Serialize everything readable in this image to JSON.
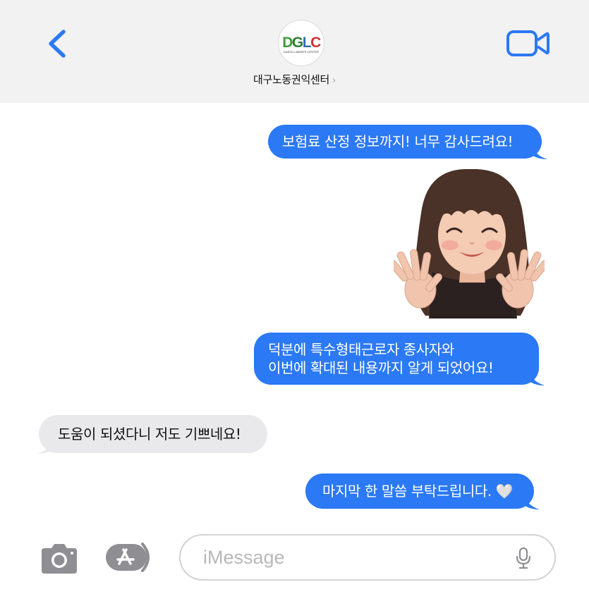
{
  "header": {
    "contact_name": "대구노동권익센터",
    "contact_chevron": "›",
    "avatar_logo_text": "DGLC",
    "avatar_logo_subtext": "DAEGU LABOR'S CENTER",
    "back_icon": "chevron-left-icon",
    "video_icon": "video-camera-icon"
  },
  "messages": [
    {
      "direction": "outgoing",
      "text": "보험료 산정 정보까지! 너무 감사드려요!"
    },
    {
      "direction": "outgoing",
      "type": "memoji-sticker"
    },
    {
      "direction": "outgoing",
      "lines": [
        "덕분에 특수형태근로자 종사자와",
        "이번에 확대된 내용까지 알게 되었어요!"
      ]
    },
    {
      "direction": "incoming",
      "text": "도움이 되셨다니 저도 기쁘네요!"
    },
    {
      "direction": "outgoing",
      "text": "마지막 한 말씀 부탁드립니다.",
      "emoji": "🤍"
    }
  ],
  "input_bar": {
    "placeholder": "iMessage",
    "camera_icon": "camera-icon",
    "apps_icon": "app-store-icon",
    "mic_icon": "microphone-icon"
  },
  "colors": {
    "accent": "#2b79f4",
    "outgoing_bubble": "#2b79f4",
    "incoming_bubble": "#e9e9eb",
    "header_bg": "#f2f2f2",
    "icon_gray": "#8e8e93"
  }
}
